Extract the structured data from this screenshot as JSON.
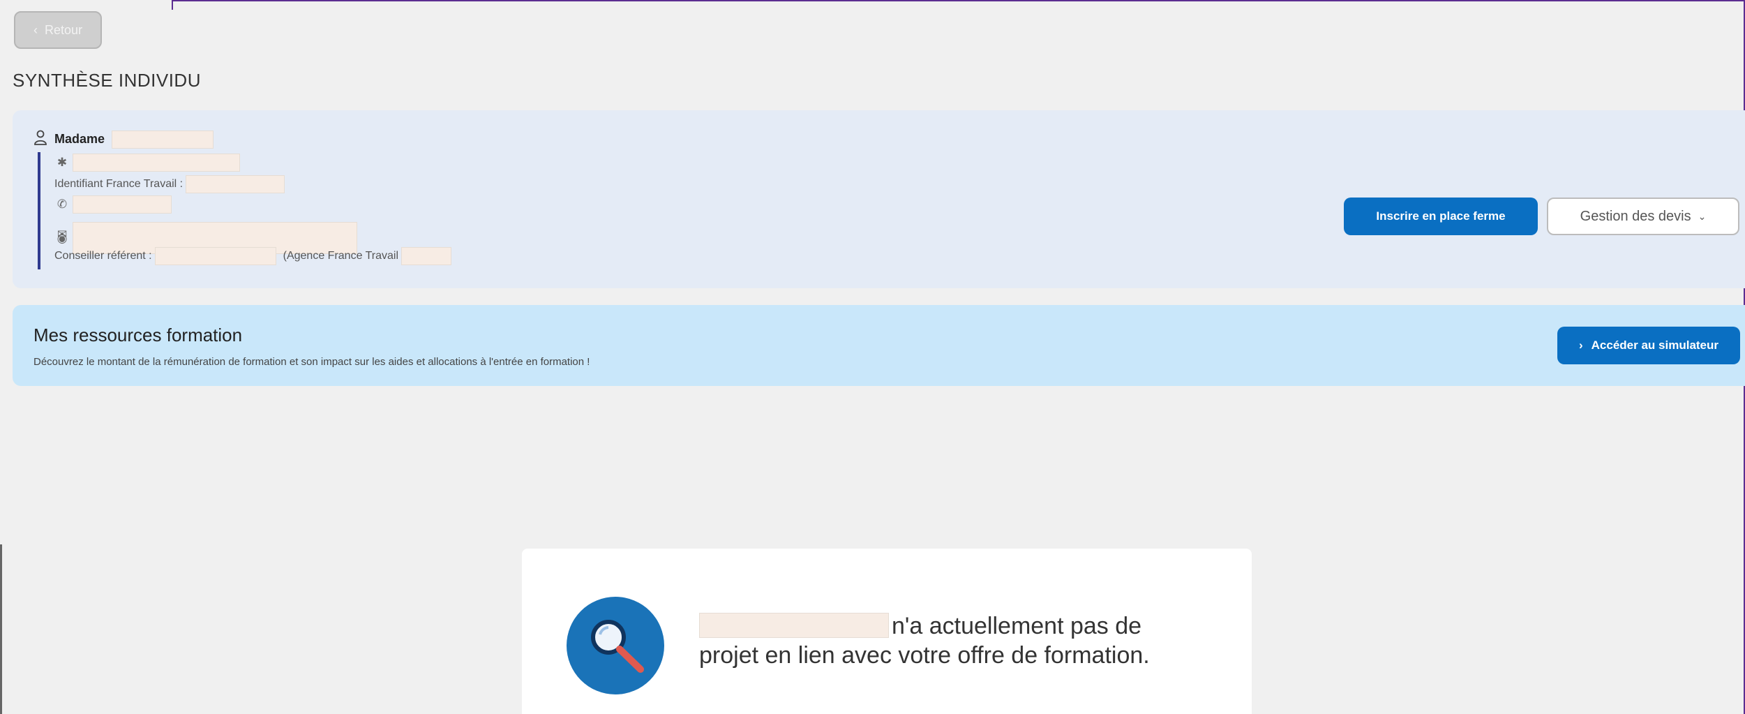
{
  "back_button": {
    "label": "Retour",
    "icon": "chevron-left-icon"
  },
  "page_title": "SYNTHÈSE INDIVIDU",
  "person": {
    "civility": "Madame",
    "france_travail_id_label": "Identifiant France Travail :",
    "advisor_label": "Conseiller référent :",
    "agency_label": "(Agence France Travail",
    "icons": [
      "user-icon",
      "asterisk-icon",
      "phone-icon",
      "email-icon",
      "location-pin-icon"
    ]
  },
  "actions": {
    "register_label": "Inscrire en place ferme",
    "quotes_label": "Gestion des devis",
    "quotes_icon": "chevron-down-icon"
  },
  "resources": {
    "title": "Mes ressources formation",
    "description": "Découvrez le montant de la rémunération de formation et son impact sur les aides et allocations à l'entrée en formation !",
    "simulator_label": "Accéder au simulateur",
    "simulator_icon": "chevron-right-icon"
  },
  "empty_state": {
    "message_part1": "n'a actuellement pas de",
    "message_part2": "projet en lien avec votre offre de formation.",
    "icon": "magnifier-icon"
  },
  "colors": {
    "primary": "#0a6fc2",
    "person_card_bg": "#e4ebf6",
    "resources_bg": "#c9e7fa",
    "frame": "#5c2d91",
    "illustration": "#1a73b8",
    "illustration_handle": "#e05a4f"
  }
}
